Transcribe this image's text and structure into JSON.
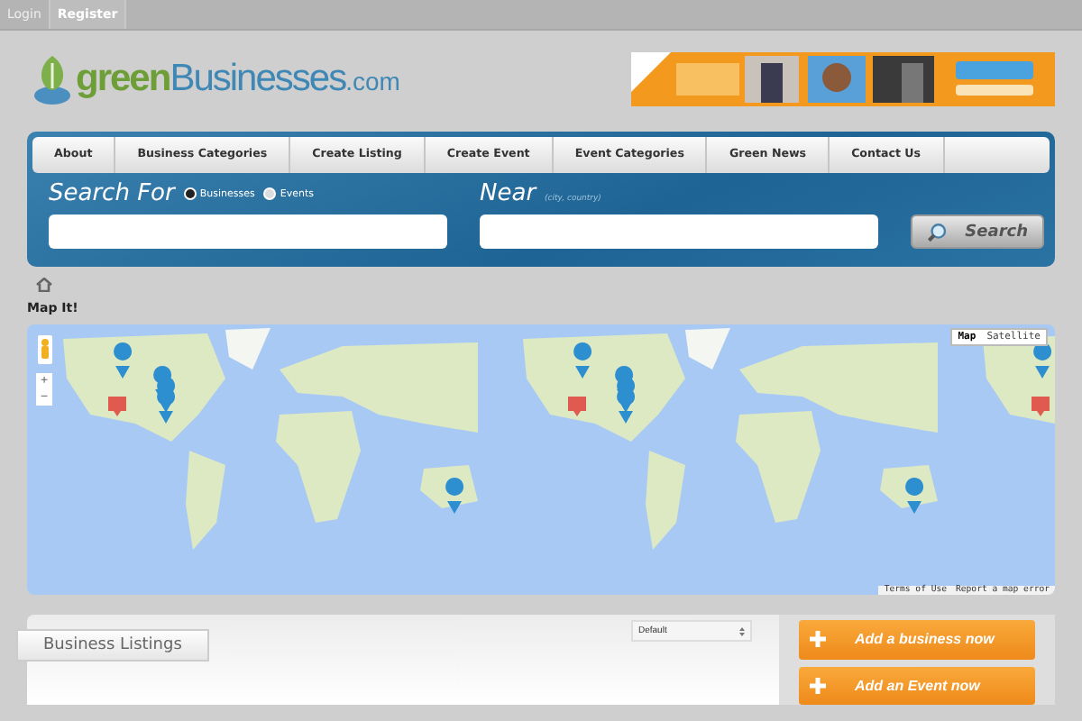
{
  "top_links": [
    {
      "label": "Login",
      "selected": false
    },
    {
      "label": "Register",
      "selected": true
    }
  ],
  "logo": {
    "part_1": "green",
    "part_2": "Businesses",
    "part_3": ".com"
  },
  "nav": [
    {
      "label": "About"
    },
    {
      "label": "Business Categories"
    },
    {
      "label": "Create Listing"
    },
    {
      "label": "Create Event"
    },
    {
      "label": "Event Categories"
    },
    {
      "label": "Green News"
    },
    {
      "label": "Contact Us"
    }
  ],
  "search": {
    "label": "Search For",
    "types": [
      {
        "label": "Businesses",
        "selected": true
      },
      {
        "label": "Events",
        "selected": false
      }
    ],
    "near_label": "Near",
    "near_hint": "(city, country)",
    "button": "Search"
  },
  "page_title": "Map It!",
  "map": {
    "map_types": [
      {
        "label": "Map",
        "selected": true
      },
      {
        "label": "Satellite",
        "selected": false
      }
    ],
    "zoom_in": "+",
    "zoom_out": "−",
    "footer_links": [
      "Terms of Use",
      "Report a map error"
    ]
  },
  "listings": {
    "title": "Business Listings",
    "sort": "Default"
  },
  "actions": [
    {
      "label": "Add a business now"
    },
    {
      "label": "Add an Event now"
    }
  ]
}
